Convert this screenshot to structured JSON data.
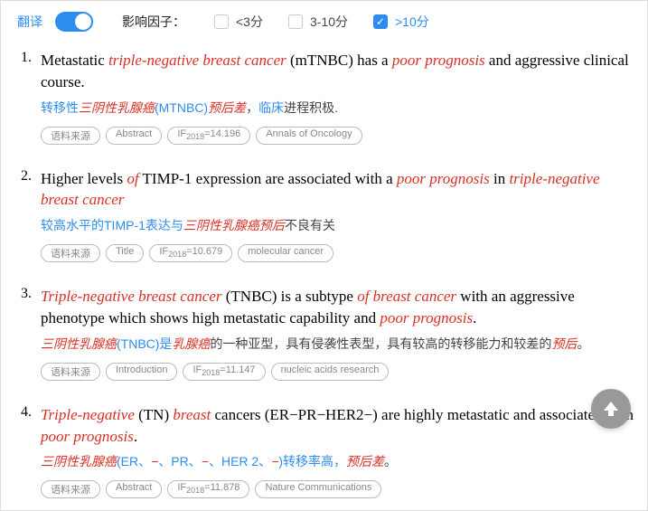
{
  "topbar": {
    "translate_label": "翻译",
    "toggle_on": true,
    "filter_label": "影响因子：",
    "filters": [
      {
        "label": "<3分",
        "checked": false
      },
      {
        "label": "3-10分",
        "checked": false
      },
      {
        "label": ">10分",
        "checked": true
      }
    ]
  },
  "tag_source_label": "语料来源",
  "if_prefix": "IF",
  "if_year": "2018",
  "items": [
    {
      "num": "1.",
      "english_segments": [
        {
          "t": "Metastatic ",
          "hl": false
        },
        {
          "t": "triple-negative breast cancer",
          "hl": true
        },
        {
          "t": " (mTNBC) has a ",
          "hl": false
        },
        {
          "t": "poor prognosis",
          "hl": true
        },
        {
          "t": " and aggressive clinical course.",
          "hl": false
        }
      ],
      "chinese_segments": [
        {
          "t": "转移性",
          "cls": ""
        },
        {
          "t": "三阴性乳腺癌",
          "cls": "zh-red"
        },
        {
          "t": "(MTNBC)",
          "cls": ""
        },
        {
          "t": "预后差",
          "cls": "zh-red"
        },
        {
          "t": "，",
          "cls": "zh-black"
        },
        {
          "t": "临床",
          "cls": ""
        },
        {
          "t": "进程积极.",
          "cls": "zh-black"
        }
      ],
      "tags": {
        "section": "Abstract",
        "if_value": "14.196",
        "journal": "Annals of Oncology"
      }
    },
    {
      "num": "2.",
      "english_segments": [
        {
          "t": "Higher levels ",
          "hl": false
        },
        {
          "t": "of",
          "hl": true
        },
        {
          "t": " TIMP-1 expression are associated with a ",
          "hl": false
        },
        {
          "t": "poor prognosis",
          "hl": true
        },
        {
          "t": " in ",
          "hl": false
        },
        {
          "t": "triple-negative breast cancer",
          "hl": true
        }
      ],
      "chinese_segments": [
        {
          "t": "较高水平的TIMP-1表达与",
          "cls": ""
        },
        {
          "t": "三阴性乳腺癌预后",
          "cls": "zh-red"
        },
        {
          "t": "不良有关",
          "cls": "zh-black"
        }
      ],
      "tags": {
        "section": "Title",
        "if_value": "10.679",
        "journal": "molecular cancer"
      }
    },
    {
      "num": "3.",
      "english_segments": [
        {
          "t": "Triple-negative breast cancer",
          "hl": true
        },
        {
          "t": " (TNBC) is a subtype ",
          "hl": false
        },
        {
          "t": "of breast cancer",
          "hl": true
        },
        {
          "t": " with an aggressive phenotype which shows high metastatic capability and ",
          "hl": false
        },
        {
          "t": "poor prognosis",
          "hl": true
        },
        {
          "t": ".",
          "hl": false
        }
      ],
      "chinese_segments": [
        {
          "t": "三阴性乳腺癌",
          "cls": "zh-red"
        },
        {
          "t": "(TNBC)是",
          "cls": ""
        },
        {
          "t": "乳腺癌",
          "cls": "zh-red"
        },
        {
          "t": "的一种亚型，具有侵袭性表型，具有较高的转移能力和较差的",
          "cls": "zh-black"
        },
        {
          "t": "预后",
          "cls": "zh-red"
        },
        {
          "t": "。",
          "cls": "zh-black"
        }
      ],
      "tags": {
        "section": "Introduction",
        "if_value": "11.147",
        "journal": "nucleic acids research"
      }
    },
    {
      "num": "4.",
      "english_segments": [
        {
          "t": "Triple-negative",
          "hl": true
        },
        {
          "t": " (TN) ",
          "hl": false
        },
        {
          "t": "breast",
          "hl": true
        },
        {
          "t": " cancers (ER−PR−HER2−) are highly metastatic and associated with ",
          "hl": false
        },
        {
          "t": "poor prognosis",
          "hl": true
        },
        {
          "t": ".",
          "hl": false
        }
      ],
      "chinese_segments": [
        {
          "t": "三阴性乳腺癌",
          "cls": "zh-red"
        },
        {
          "t": "(ER、",
          "cls": ""
        },
        {
          "t": "−",
          "cls": "zh-red"
        },
        {
          "t": "、PR、",
          "cls": ""
        },
        {
          "t": "−",
          "cls": "zh-red"
        },
        {
          "t": "、HER 2、",
          "cls": ""
        },
        {
          "t": "−",
          "cls": "zh-red"
        },
        {
          "t": ")转移率高，",
          "cls": ""
        },
        {
          "t": "预后差",
          "cls": "zh-red"
        },
        {
          "t": "。",
          "cls": "zh-black"
        }
      ],
      "tags": {
        "section": "Abstract",
        "if_value": "11.878",
        "journal": "Nature Communications"
      }
    }
  ]
}
